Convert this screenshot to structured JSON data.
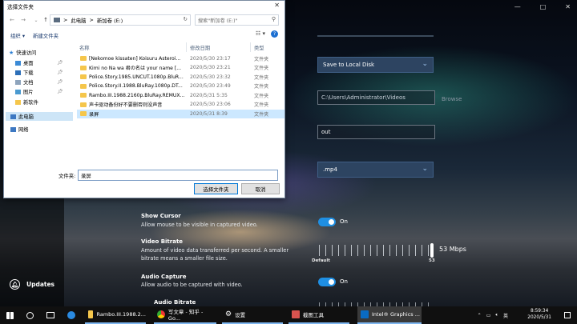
{
  "capture_app": {
    "window_controls": [
      "—",
      "□",
      "✕"
    ],
    "save_location": "Save to Local Disk",
    "folder_path": "C:\\Users\\Administrator\\Videos",
    "browse_label": "Browse",
    "filename_prefix": "out",
    "format": ".mp4",
    "show_cursor": {
      "title": "Show Cursor",
      "desc": "Allow mouse to be visible in captured video.",
      "state": "On"
    },
    "video_bitrate": {
      "title": "Video Bitrate",
      "desc": "Amount of video data transferred per second. A smaller bitrate means a smaller file size.",
      "value": "53 Mbps",
      "min_label": "Default",
      "max_label": "53",
      "fraction": 1.0
    },
    "audio_capture": {
      "title": "Audio Capture",
      "desc": "Allow audio to be captured with video.",
      "state": "On"
    },
    "audio_bitrate": {
      "title": "Audio Bitrate"
    },
    "updates_label": "Updates"
  },
  "dialog": {
    "title": "选择文件夹",
    "close": "✕",
    "nav": {
      "back": "←",
      "forward": "→",
      "up": "↑"
    },
    "breadcrumb": [
      "此电脑",
      "新加卷 (E:)"
    ],
    "breadcrumb_sep": ">",
    "refresh": "↻",
    "search_placeholder": "搜索\"新加卷 (E:)\"",
    "toolbar": {
      "organize": "组织 ▾",
      "new_folder": "新建文件夹",
      "view": "☷ ▾",
      "help": "?"
    },
    "nav_pane": {
      "quick_access": "快速访问",
      "items": [
        {
          "label": "桌面",
          "pinned": true
        },
        {
          "label": "下载",
          "pinned": true
        },
        {
          "label": "文档",
          "pinned": true
        },
        {
          "label": "图片",
          "pinned": true
        },
        {
          "label": "新软件",
          "pinned": false
        }
      ],
      "this_pc": "此电脑",
      "network": "网络"
    },
    "columns": {
      "name": "名称",
      "date": "修改日期",
      "type": "类型"
    },
    "files": [
      {
        "name": "[Nekomoe kissaten] Koisuru Asteroi...",
        "date": "2020/5/30 23:17",
        "type": "文件夹"
      },
      {
        "name": "Kimi no Na wa 君の名は your name [...",
        "date": "2020/5/30 23:21",
        "type": "文件夹"
      },
      {
        "name": "Police.Story.1985.UNCUT.1080p.BluR...",
        "date": "2020/5/30 23:32",
        "type": "文件夹"
      },
      {
        "name": "Police.Story.II.1988.BluRay.1080p.DT...",
        "date": "2020/5/30 23:49",
        "type": "文件夹"
      },
      {
        "name": "Rambo.III.1988.2160p.BluRay.REMUX...",
        "date": "2020/5/31 5:35",
        "type": "文件夹"
      },
      {
        "name": "声卡驱动备份好不要删否则没声音",
        "date": "2020/5/30 23:06",
        "type": "文件夹"
      },
      {
        "name": "录屏",
        "date": "2020/5/31 8:39",
        "type": "文件夹",
        "selected": true
      }
    ],
    "folder_label": "文件夹:",
    "folder_value": "录屏",
    "select_button": "选择文件夹",
    "cancel_button": "取消"
  },
  "taskbar": {
    "apps": [
      {
        "label": "Rambo.III.1988.2...",
        "state": "open"
      },
      {
        "label": "写文章 - 知乎 - Go...",
        "state": "open"
      },
      {
        "label": "设置",
        "state": "open"
      },
      {
        "label": "截图工具",
        "state": "open"
      },
      {
        "label": "Intel® Graphics ...",
        "state": "active"
      }
    ],
    "clock_time": "8:59:34",
    "clock_date": "2020/5/31",
    "ime": "英"
  }
}
